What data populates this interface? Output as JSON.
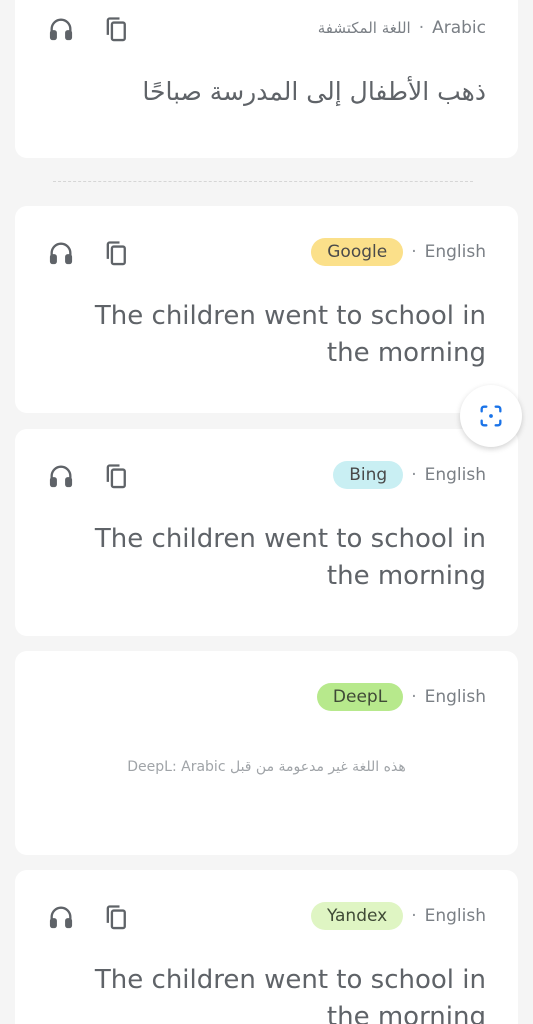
{
  "source": {
    "language_label": "Arabic",
    "language_detected_label": "اللغة المكتشفة",
    "text": "ذهب الأطفال إلى المدرسة صباحًا"
  },
  "results": [
    {
      "engine": "Google",
      "target_language": "English",
      "badge_color": "#fbe08a",
      "badge_text_color": "#4a4a4a",
      "text": "The children went to school in the morning"
    },
    {
      "engine": "Bing",
      "target_language": "English",
      "badge_color": "#c9eff3",
      "badge_text_color": "#4a4a4a",
      "text": "The children went to school in the morning"
    },
    {
      "engine": "DeepL",
      "target_language": "English",
      "badge_color": "#b7e98c",
      "badge_text_color": "#3f4a36",
      "note": "هذه اللغة غير مدعومة من قبل DeepL: Arabic"
    },
    {
      "engine": "Yandex",
      "target_language": "English",
      "badge_color": "#dff5c3",
      "badge_text_color": "#3f4a36",
      "text": "The children went to school in the morning"
    }
  ],
  "separator": "·",
  "icons": {
    "listen": "headphones-icon",
    "copy": "copy-icon",
    "scan": "scan-icon"
  },
  "colors": {
    "background": "#f5f5f5",
    "card": "#ffffff",
    "icon": "#5f6368",
    "scan_accent": "#1a73e8"
  }
}
